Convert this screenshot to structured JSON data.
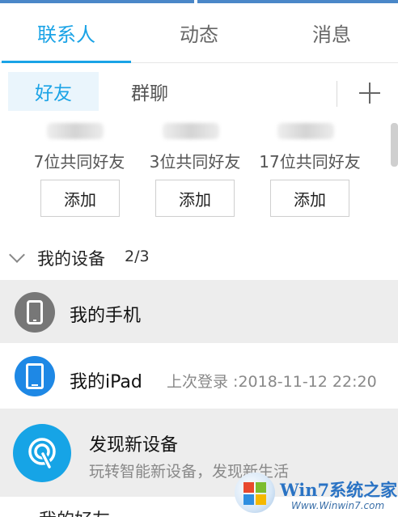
{
  "tabs": [
    {
      "label": "联系人",
      "active": true
    },
    {
      "label": "动态",
      "active": false
    },
    {
      "label": "消息",
      "active": false
    }
  ],
  "subtabs": [
    {
      "label": "好友",
      "active": true
    },
    {
      "label": "群聊",
      "active": false
    }
  ],
  "add_icon": "plus-icon",
  "suggestions": [
    {
      "mutual": "7位共同好友",
      "button": "添加"
    },
    {
      "mutual": "3位共同好友",
      "button": "添加"
    },
    {
      "mutual": "17位共同好友",
      "button": "添加"
    }
  ],
  "devices_section": {
    "title": "我的设备",
    "count": "2/3",
    "items": [
      {
        "name": "我的手机",
        "sub": "",
        "icon": "phone-icon"
      },
      {
        "name": "我的iPad",
        "sub": "上次登录 :2018-11-12 22:20",
        "icon": "tablet-icon"
      },
      {
        "name": "发现新设备",
        "sub": "玩转智能新设备，发现新生活",
        "icon": "signal-icon"
      }
    ]
  },
  "next_section_label": "我的好友",
  "watermark": {
    "title": "Win7系统之家",
    "url": "Www.Winwin7.com"
  },
  "colors": {
    "accent": "#1aa3e6",
    "row_highlight": "#ededed",
    "device_gray": "#777777",
    "device_blue": "#1e88e5"
  }
}
